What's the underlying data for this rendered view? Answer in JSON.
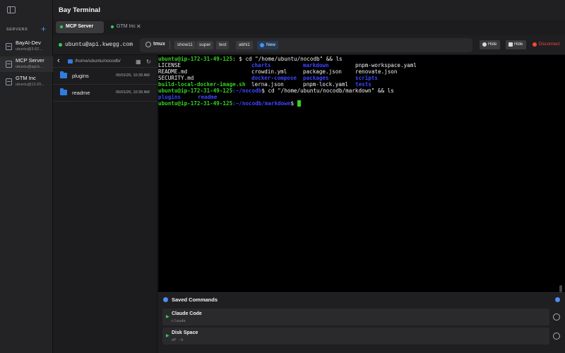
{
  "app": {
    "title": "Bay Terminal"
  },
  "sidebar": {
    "section_label": "SERVERS",
    "add_icon": "plus-icon",
    "servers": [
      {
        "name": "BayAI-Dev",
        "host": "ubuntu@3.62...",
        "active": false
      },
      {
        "name": "MCP Server",
        "host": "ubuntu@api.k...",
        "active": true
      },
      {
        "name": "GTM Inc",
        "host": "ubuntu@13.20...",
        "active": false
      }
    ]
  },
  "tabs": [
    {
      "label": "MCP Server",
      "active": true,
      "status": "connected"
    },
    {
      "label": "GTM Inc",
      "active": false,
      "status": "connected"
    }
  ],
  "connection": {
    "host": "ubuntu@api.kwegg.com",
    "tmux_label": "tmux",
    "sessions": [
      "show11",
      "super",
      "test",
      "abhi1"
    ],
    "new_label": "New",
    "hide_label_1": "Hide",
    "hide_label_2": "Hide",
    "disconnect_label": "Disconnect"
  },
  "files": {
    "path": "/home/ubuntu/nocodb/",
    "items": [
      {
        "name": "plugins",
        "date": "05/01/26, 10:39 AM"
      },
      {
        "name": "readme",
        "date": "05/01/26, 10:39 AM"
      }
    ]
  },
  "terminal": {
    "prompt_user": "ubuntu@ip-172-31-49-125",
    "line1_cmd": ": $ cd \"/home/ubuntu/nocodb\" && ls",
    "ls_rows": [
      [
        "LICENSE",
        "charts",
        "markdown",
        "pnpm-workspace.yaml"
      ],
      [
        "README.md",
        "crowdin.yml",
        "package.json",
        "renovate.json"
      ],
      [
        "SECURITY.md",
        "docker-compose",
        "packages",
        "scripts"
      ],
      [
        "build-local-docker-image.sh",
        "lerna.json",
        "pnpm-lock.yaml",
        "tests"
      ]
    ],
    "line2_path": ":~/nocodb",
    "line2_cmd": "$ cd \"/home/ubuntu/nocodb/markdown\" && ls",
    "ls2": [
      "plugins",
      "readme"
    ],
    "line3_path": ":~/nocodb/markdown",
    "line3_cmd": "$"
  },
  "saved_commands": {
    "title": "Saved Commands",
    "items": [
      {
        "name": "Claude Code",
        "command": "claude"
      },
      {
        "name": "Disk Space",
        "command": "df -h"
      }
    ]
  },
  "colors": {
    "prompt_green": "#34d321",
    "dir_blue": "#3d45ff",
    "accent": "#4d8ff0",
    "danger": "#ff453a",
    "status_green": "#30d158"
  }
}
